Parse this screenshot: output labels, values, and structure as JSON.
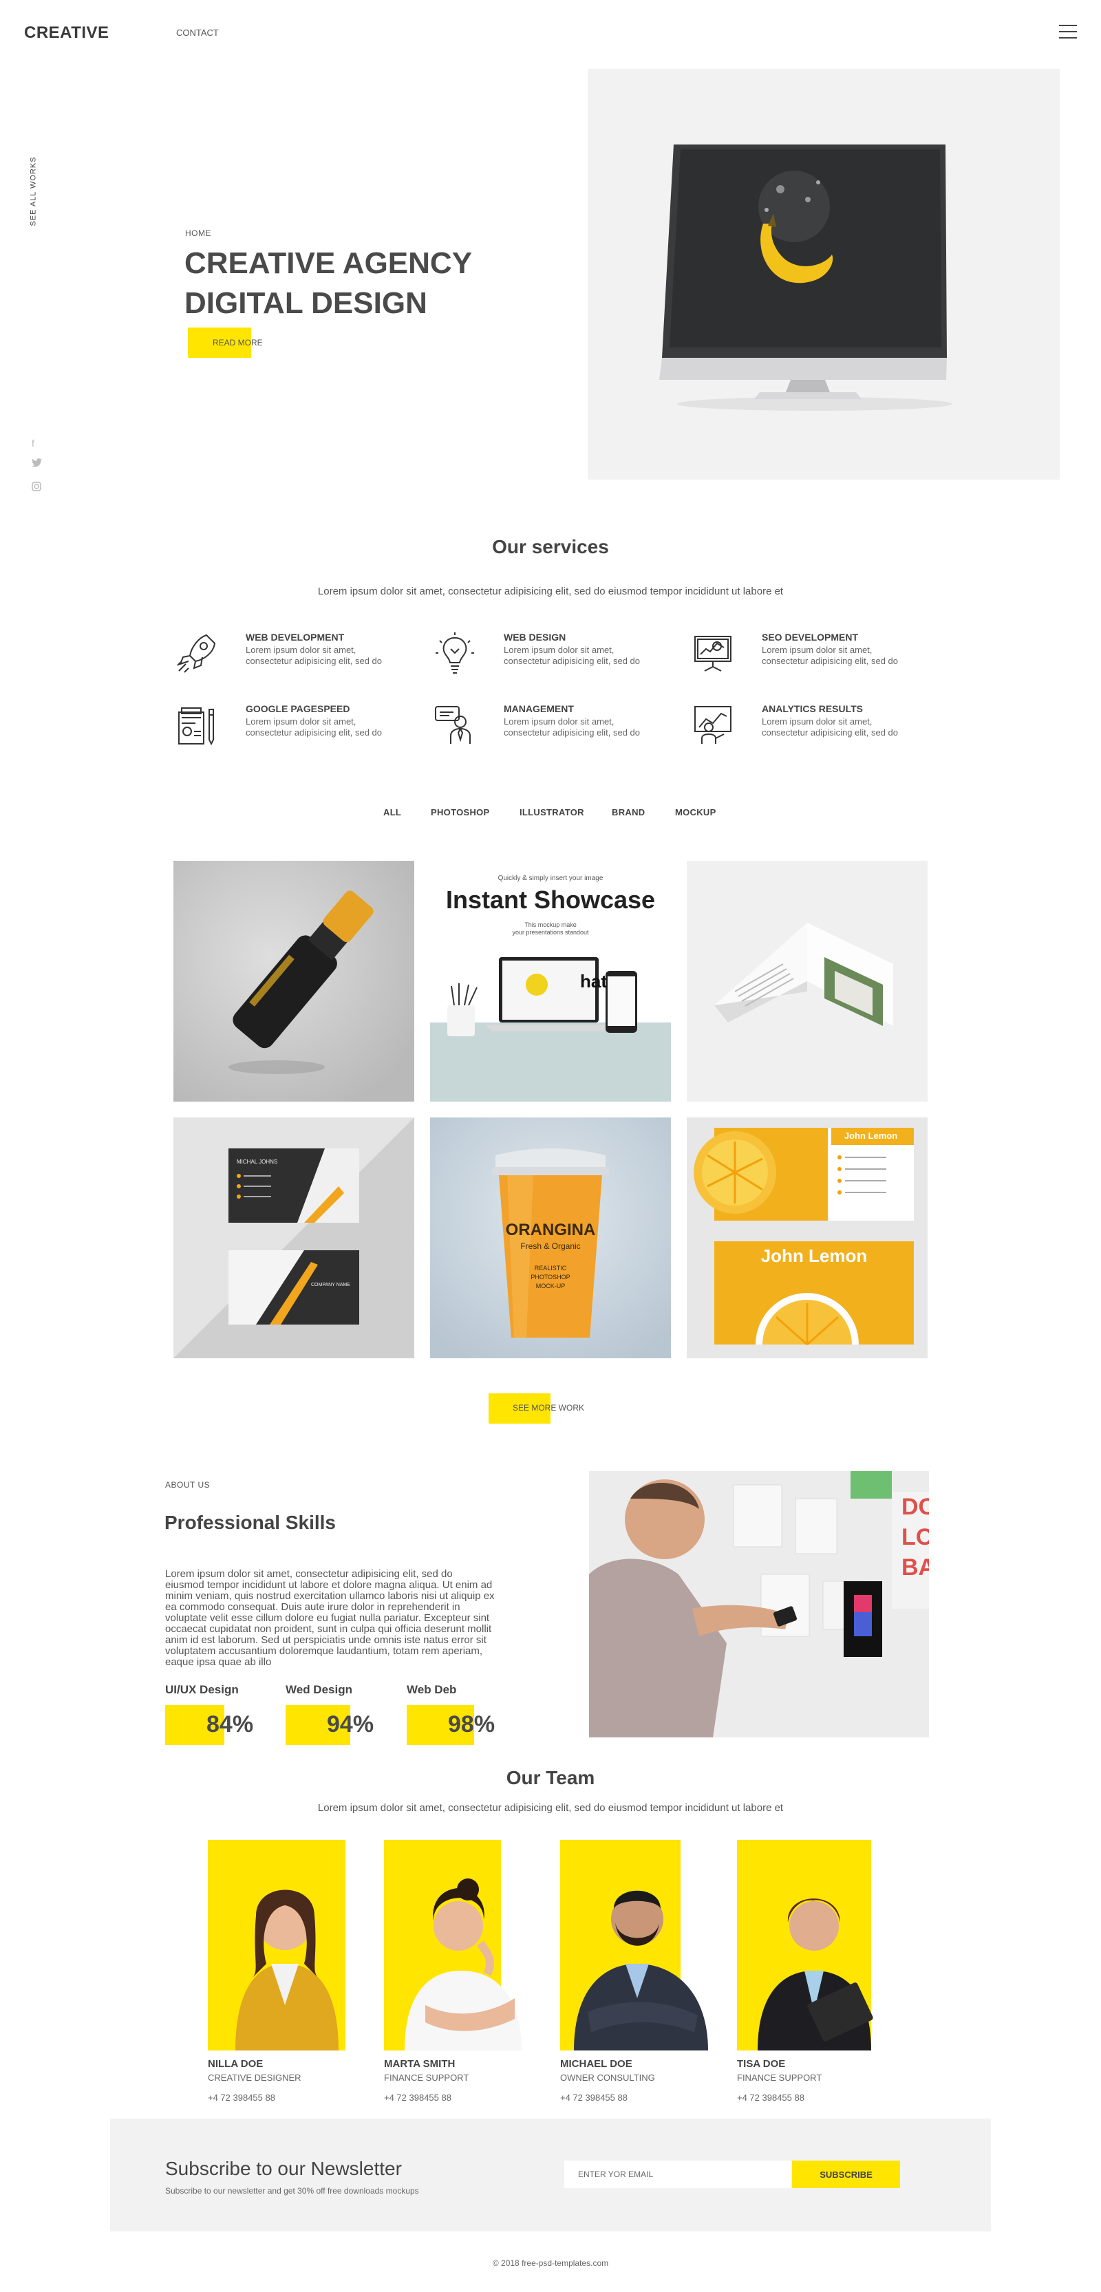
{
  "header": {
    "logo": "CREATIVE",
    "nav_contact": "CONTACT"
  },
  "side": {
    "see_all": "SEE ALL WORKS",
    "social": [
      "f",
      "t",
      "◎"
    ]
  },
  "hero": {
    "crumb": "HOME",
    "title_line1": "CREATIVE AGENCY",
    "title_line2": "DIGITAL DESIGN",
    "button": "READ MORE"
  },
  "services": {
    "title": "Our services",
    "subtitle": "Lorem ipsum dolor sit amet, consectetur adipisicing elit, sed do eiusmod tempor incididunt ut labore et",
    "items": [
      {
        "title": "WEB DEVELOPMENT",
        "desc1": "Lorem ipsum dolor sit amet,",
        "desc2": "consectetur adipisicing elit, sed do",
        "icon": "rocket-icon"
      },
      {
        "title": "WEB DESIGN",
        "desc1": "Lorem ipsum dolor sit amet,",
        "desc2": "consectetur adipisicing elit, sed do",
        "icon": "lightbulb-icon"
      },
      {
        "title": "SEO DEVELOPMENT",
        "desc1": "Lorem ipsum dolor sit amet,",
        "desc2": "consectetur adipisicing elit, sed do",
        "icon": "presentation-icon"
      },
      {
        "title": "GOOGLE PAGESPEED",
        "desc1": "Lorem ipsum dolor sit amet,",
        "desc2": "consectetur adipisicing elit, sed do",
        "icon": "clipboard-icon"
      },
      {
        "title": "MANAGEMENT",
        "desc1": "Lorem ipsum dolor sit amet,",
        "desc2": "consectetur adipisicing elit, sed do",
        "icon": "manager-icon"
      },
      {
        "title": "ANALYTICS RESULTS",
        "desc1": "Lorem ipsum dolor sit amet,",
        "desc2": "consectetur adipisicing elit, sed do",
        "icon": "analytics-icon"
      }
    ]
  },
  "filters": [
    "ALL",
    "PHOTOSHOP",
    "ILLUSTRATOR",
    "BRAND",
    "MOCKUP"
  ],
  "gallery": {
    "showcase_small": "Quickly & simply insert your image",
    "showcase_title": "Instant Showcase",
    "showcase_sub1": "This mockup make",
    "showcase_sub2": "your presentations standout",
    "showcase_hat": "hat",
    "cup_brand": "ORANGINA",
    "cup_tag": "Fresh & Organic",
    "cup_l1": "REALISTIC",
    "cup_l2": "PHOTOSHOP",
    "cup_l3": "MOCK-UP",
    "card_name": "John Lemon",
    "bcard_name": "MICHAL JOHNS",
    "bcard_company": "COMPANY NAME"
  },
  "see_more": "SEE MORE WORK",
  "about": {
    "label": "ABOUT US",
    "title": "Professional Skills",
    "lines": [
      "Lorem ipsum dolor sit amet, consectetur adipisicing elit, sed do",
      "eiusmod tempor incididunt ut labore et dolore magna aliqua. Ut enim ad",
      "minim veniam, quis nostrud exercitation ullamco laboris nisi ut aliquip ex",
      "ea commodo consequat. Duis aute irure dolor in reprehenderit in",
      "voluptate velit esse cillum dolore eu fugiat nulla pariatur. Excepteur sint",
      "occaecat cupidatat non proident, sunt in culpa qui officia deserunt mollit",
      "anim id est laborum. Sed ut perspiciatis unde omnis iste natus error sit",
      "voluptatem accusantium doloremque laudantium, totam rem aperiam,",
      "eaque ipsa quae ab illo"
    ],
    "skills": [
      {
        "name": "UI/UX Design",
        "value": "84%"
      },
      {
        "name": "Wed Design",
        "value": "94%"
      },
      {
        "name": "Web Deb",
        "value": "98%"
      }
    ],
    "poster_text": "DO\nLO\nBA"
  },
  "team": {
    "title": "Our Team",
    "subtitle": "Lorem ipsum dolor sit amet, consectetur adipisicing elit, sed do eiusmod tempor incididunt ut labore et",
    "members": [
      {
        "name": "NILLA DOE",
        "role": "CREATIVE DESIGNER",
        "phone": "+4 72 398455 88"
      },
      {
        "name": "MARTA SMITH",
        "role": "FINANCE SUPPORT",
        "phone": "+4 72 398455 88"
      },
      {
        "name": "MICHAEL DOE",
        "role": "OWNER CONSULTING",
        "phone": "+4 72 398455 88"
      },
      {
        "name": "TISA DOE",
        "role": "FINANCE SUPPORT",
        "phone": "+4 72 398455 88"
      }
    ]
  },
  "newsletter": {
    "title": "Subscribe to our Newsletter",
    "subtitle": "Subscribe to our newsletter and get 30% off free downloads mockups",
    "placeholder": "ENTER YOR EMAIL",
    "button": "SUBSCRIBE"
  },
  "footer": "© 2018 free-psd-templates.com",
  "colors": {
    "accent": "#ffe500",
    "text": "#444444",
    "panel": "#f2f2f2"
  }
}
